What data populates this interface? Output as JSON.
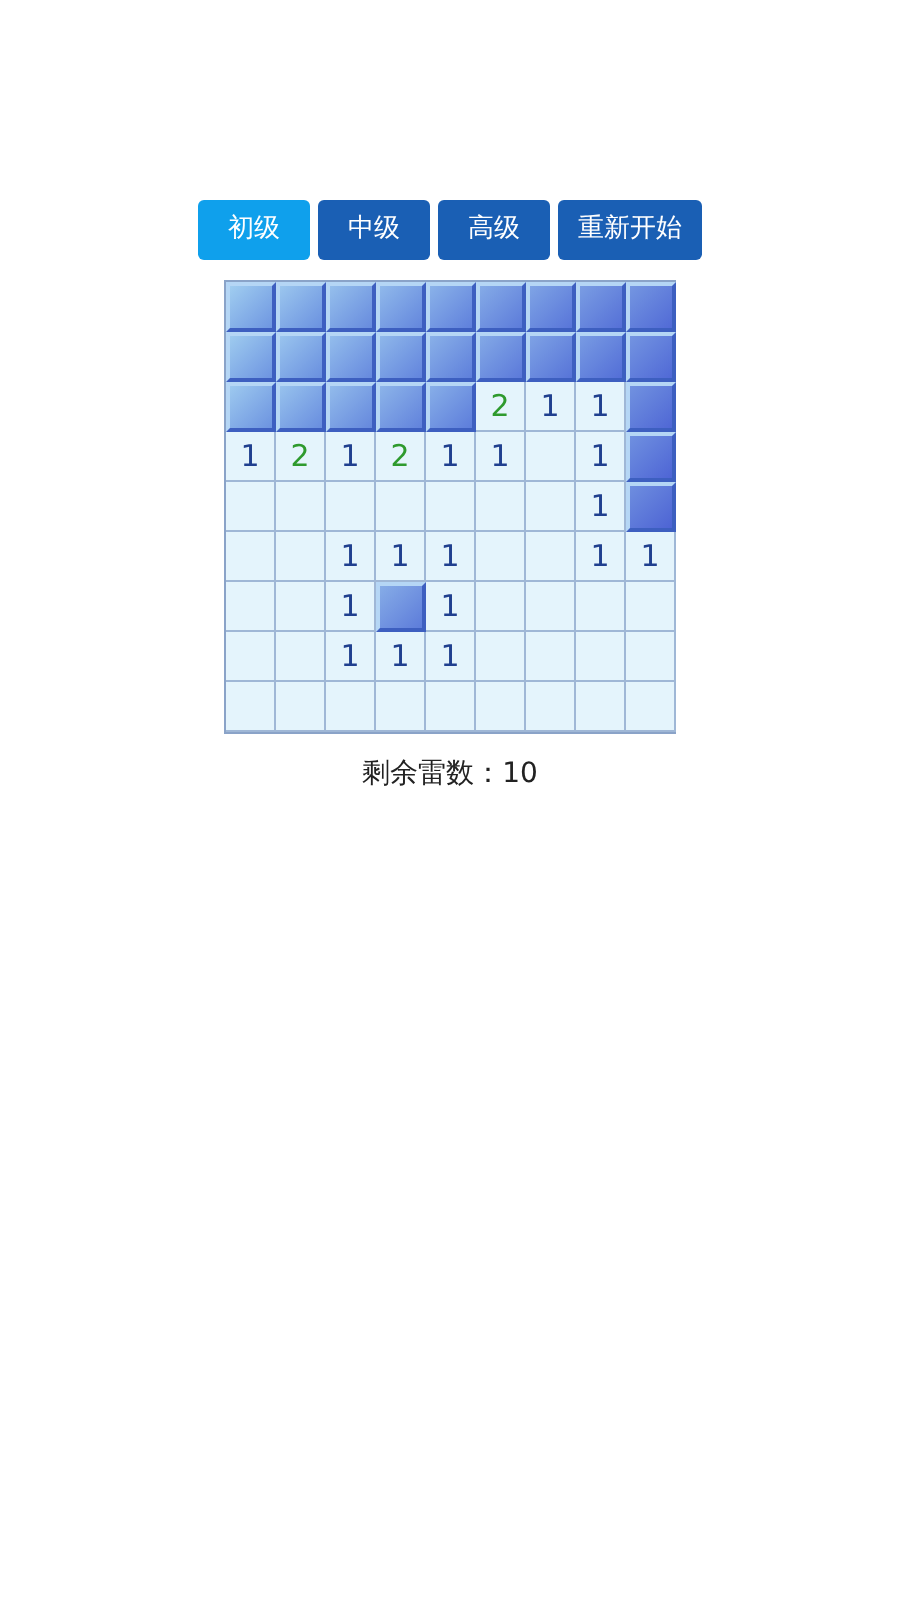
{
  "levels": [
    {
      "label": "初级",
      "selected": true
    },
    {
      "label": "中级",
      "selected": false
    },
    {
      "label": "高级",
      "selected": false
    }
  ],
  "restart_button": "重新开始",
  "grid": [
    [
      {
        "covered": true
      },
      {
        "covered": true
      },
      {
        "covered": true
      },
      {
        "covered": true
      },
      {
        "covered": true
      },
      {
        "covered": true
      },
      {
        "covered": true
      },
      {
        "covered": true
      },
      {
        "covered": true
      }
    ],
    [
      {
        "covered": true
      },
      {
        "covered": true
      },
      {
        "covered": true
      },
      {
        "covered": true
      },
      {
        "covered": true
      },
      {
        "covered": true
      },
      {
        "covered": true
      },
      {
        "covered": true
      },
      {
        "covered": true
      }
    ],
    [
      {
        "covered": true
      },
      {
        "covered": true
      },
      {
        "covered": true
      },
      {
        "covered": true
      },
      {
        "covered": true
      },
      {
        "covered": false,
        "count": "2",
        "color": "#2e9a2e"
      },
      {
        "covered": false,
        "count": "1",
        "color": "#1f3f8f"
      },
      {
        "covered": false,
        "count": "1",
        "color": "#1f3f8f"
      },
      {
        "covered": true
      }
    ],
    [
      {
        "covered": false,
        "count": "1",
        "color": "#1f3f8f"
      },
      {
        "covered": false,
        "count": "2",
        "color": "#2e9a2e"
      },
      {
        "covered": false,
        "count": "1",
        "color": "#1f3f8f"
      },
      {
        "covered": false,
        "count": "2",
        "color": "#2e9a2e"
      },
      {
        "covered": false,
        "count": "1",
        "color": "#1f3f8f"
      },
      {
        "covered": false,
        "count": "1",
        "color": "#1f3f8f"
      },
      {
        "covered": false
      },
      {
        "covered": false,
        "count": "1",
        "color": "#1f3f8f"
      },
      {
        "covered": true
      }
    ],
    [
      {
        "covered": false
      },
      {
        "covered": false
      },
      {
        "covered": false
      },
      {
        "covered": false
      },
      {
        "covered": false
      },
      {
        "covered": false
      },
      {
        "covered": false
      },
      {
        "covered": false,
        "count": "1",
        "color": "#1f3f8f"
      },
      {
        "covered": true
      }
    ],
    [
      {
        "covered": false
      },
      {
        "covered": false
      },
      {
        "covered": false,
        "count": "1",
        "color": "#1f3f8f"
      },
      {
        "covered": false,
        "count": "1",
        "color": "#1f3f8f"
      },
      {
        "covered": false,
        "count": "1",
        "color": "#1f3f8f"
      },
      {
        "covered": false
      },
      {
        "covered": false
      },
      {
        "covered": false,
        "count": "1",
        "color": "#1f3f8f"
      },
      {
        "covered": false,
        "count": "1",
        "color": "#1f3f8f"
      }
    ],
    [
      {
        "covered": false
      },
      {
        "covered": false
      },
      {
        "covered": false,
        "count": "1",
        "color": "#1f3f8f"
      },
      {
        "covered": true
      },
      {
        "covered": false,
        "count": "1",
        "color": "#1f3f8f"
      },
      {
        "covered": false
      },
      {
        "covered": false
      },
      {
        "covered": false
      },
      {
        "covered": false
      }
    ],
    [
      {
        "covered": false
      },
      {
        "covered": false
      },
      {
        "covered": false,
        "count": "1",
        "color": "#1f3f8f"
      },
      {
        "covered": false,
        "count": "1",
        "color": "#1f3f8f"
      },
      {
        "covered": false,
        "count": "1",
        "color": "#1f3f8f"
      },
      {
        "covered": false
      },
      {
        "covered": false
      },
      {
        "covered": false
      },
      {
        "covered": false
      }
    ],
    [
      {
        "covered": false
      },
      {
        "covered": false
      },
      {
        "covered": false
      },
      {
        "covered": false
      },
      {
        "covered": false
      },
      {
        "covered": false
      },
      {
        "covered": false
      },
      {
        "covered": false
      },
      {
        "covered": false
      }
    ]
  ],
  "mines_left": "剩余雷数：10"
}
